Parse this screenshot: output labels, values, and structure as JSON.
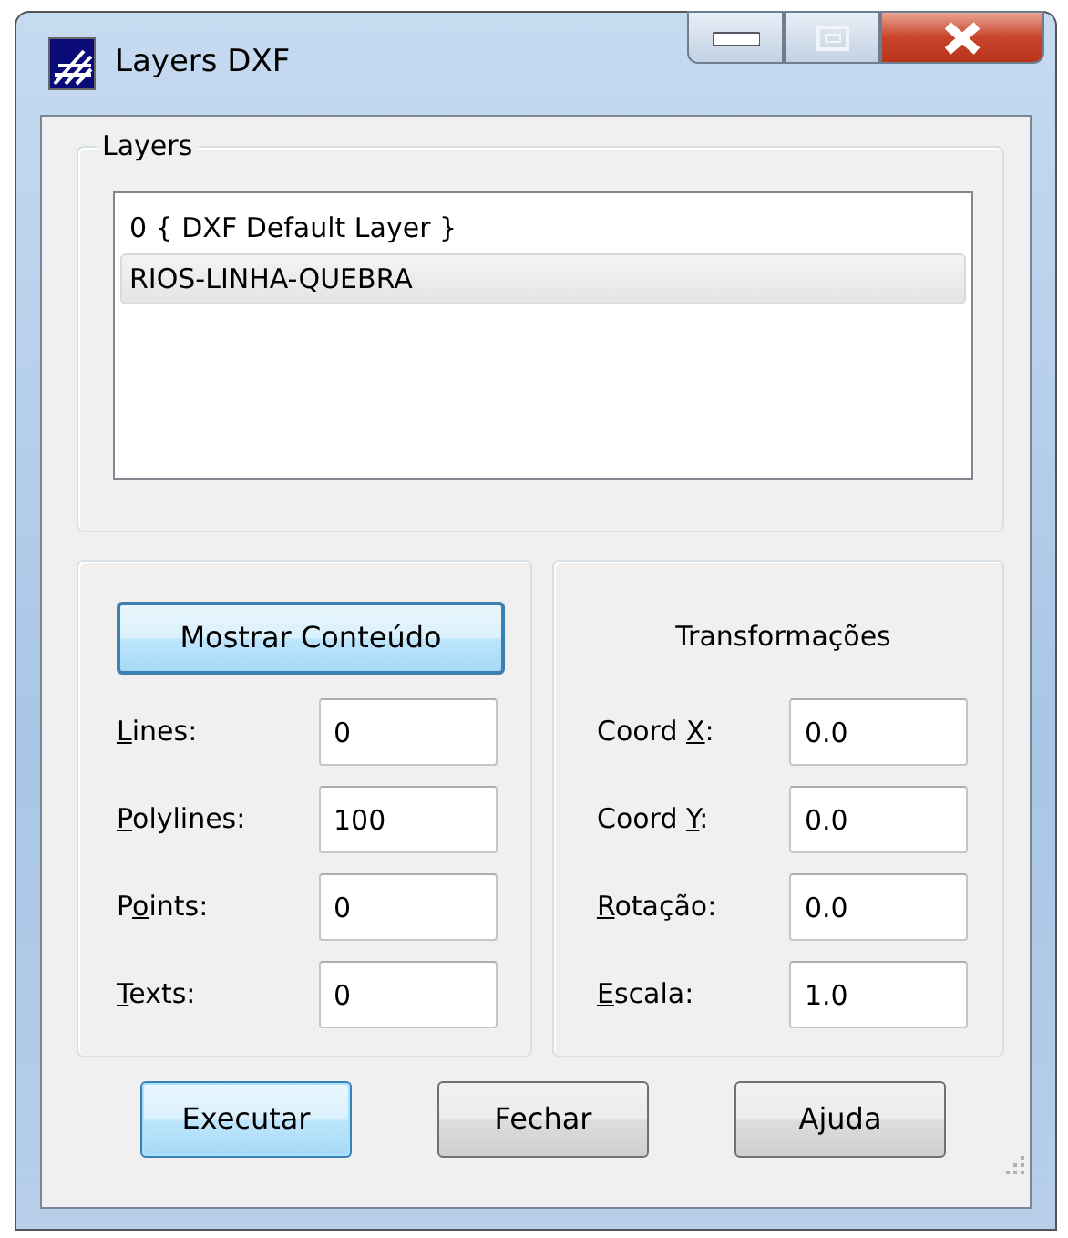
{
  "window": {
    "title": "Layers DXF"
  },
  "layers_group": {
    "title": "Layers",
    "items": [
      {
        "label": "0 { DXF Default Layer }",
        "selected": false
      },
      {
        "label": "RIOS-LINHA-QUEBRA",
        "selected": true
      }
    ]
  },
  "counts_group": {
    "button": {
      "label": "Mostrar Conteúdo",
      "focused": true
    },
    "fields": [
      {
        "label_key": "L",
        "label_after": "ines:",
        "value": "0"
      },
      {
        "label_key": "P",
        "label_after": "olylines:",
        "value": "100"
      },
      {
        "label_before": "P",
        "label_key": "o",
        "label_after": "ints:",
        "value": "0"
      },
      {
        "label_key": "T",
        "label_after": "exts:",
        "value": "0"
      }
    ]
  },
  "transform_group": {
    "title": "Transformações",
    "fields": [
      {
        "label_before": "Coord ",
        "label_key": "X",
        "label_after": ":",
        "value": "0.0"
      },
      {
        "label_before": "Coord ",
        "label_key": "Y",
        "label_after": ":",
        "value": "0.0"
      },
      {
        "label_key": "R",
        "label_after": "otação:",
        "value": "0.0"
      },
      {
        "label_key": "E",
        "label_after": "scala:",
        "value": "1.0"
      }
    ]
  },
  "buttons": [
    {
      "label": "Executar",
      "default": true
    },
    {
      "label": "Fechar",
      "default": false
    },
    {
      "label": "Ajuda",
      "default": false
    }
  ]
}
